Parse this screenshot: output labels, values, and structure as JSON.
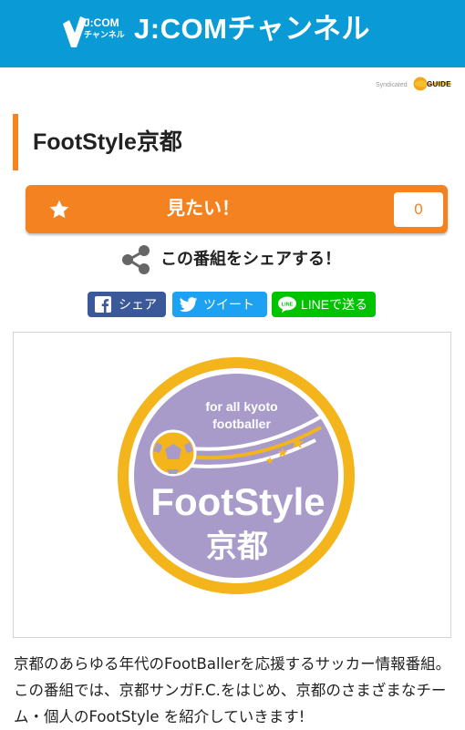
{
  "header": {
    "logo_text_line1": "J:COM",
    "logo_text_line2": "チャンネル",
    "title": "J:COMチャンネル"
  },
  "credit": {
    "syndicated": "Syndicated",
    "guide": "GUIDE"
  },
  "program": {
    "title": "FootStyle京都"
  },
  "want": {
    "label": "見たい！",
    "count": "0"
  },
  "share": {
    "heading": "この番組をシェアする！",
    "facebook": "シェア",
    "twitter": "ツイート",
    "line": "LINEで送る"
  },
  "show_image": {
    "tagline_line1": "for all kyoto",
    "tagline_line2": "footballer",
    "name_line1": "FootStyle",
    "name_line2": "京都"
  },
  "description": "京都のあらゆる年代のFootBallerを応援するサッカー情報番組。この番組では、京都サンガF.C.をはじめ、京都のさまざまなチーム・個人のFootStyle を紹介していきます!",
  "colors": {
    "header_bg": "#0a9bd6",
    "accent_orange": "#f58220",
    "facebook": "#3b5998",
    "twitter": "#1da1f2",
    "line": "#00c300",
    "logo_ring": "#f3b41c",
    "logo_purple": "#a89bc9"
  }
}
